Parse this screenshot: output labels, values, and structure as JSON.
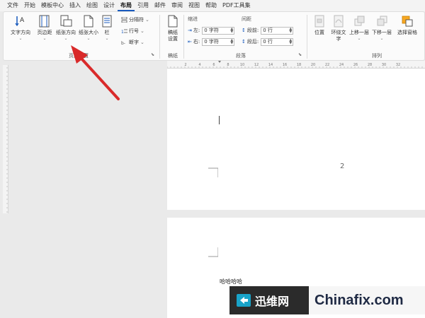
{
  "menu": {
    "tabs": [
      "文件",
      "开始",
      "模板中心",
      "插入",
      "绘图",
      "设计",
      "布局",
      "引用",
      "邮件",
      "审阅",
      "视图",
      "帮助",
      "PDF工具集"
    ],
    "active": "布局"
  },
  "ribbon": {
    "page_setup": {
      "text_direction": "文字方向",
      "margins": "页边距",
      "orientation": "纸张方向",
      "size": "纸张大小",
      "columns": "栏",
      "breaks": "分隔符",
      "line_numbers": "行号",
      "hyphenation": "断字",
      "group_label": "页面设置"
    },
    "manuscript": {
      "button_line1": "稿纸",
      "button_line2": "设置",
      "group_label": "稿纸"
    },
    "paragraph": {
      "indent_header": "缩进",
      "spacing_header": "间距",
      "left_label": "左:",
      "left_value": "0 字符",
      "right_label": "右:",
      "right_value": "0 字符",
      "before_label": "段前:",
      "before_value": "0 行",
      "after_label": "段后:",
      "after_value": "0 行",
      "group_label": "段落"
    },
    "arrange": {
      "position": "位置",
      "wrap_line1": "环绕文",
      "wrap_line2": "字",
      "bring_forward": "上移一层",
      "send_backward": "下移一层",
      "selection_pane": "选择窗格",
      "group_label": "排列"
    }
  },
  "ruler": {
    "labels": [
      "2",
      "4",
      "6",
      "8",
      "10",
      "12",
      "14",
      "16",
      "18",
      "20",
      "22",
      "24",
      "26",
      "28",
      "30",
      "32"
    ]
  },
  "document": {
    "page_number": "2",
    "page2_text": "哈哈哈哈"
  },
  "watermark": {
    "cn": "迅维网",
    "en": "Chinafix.com"
  },
  "colors": {
    "accent": "#185abd",
    "arrow": "#d92a2a",
    "watermark_dark": "#2b2b2b"
  }
}
